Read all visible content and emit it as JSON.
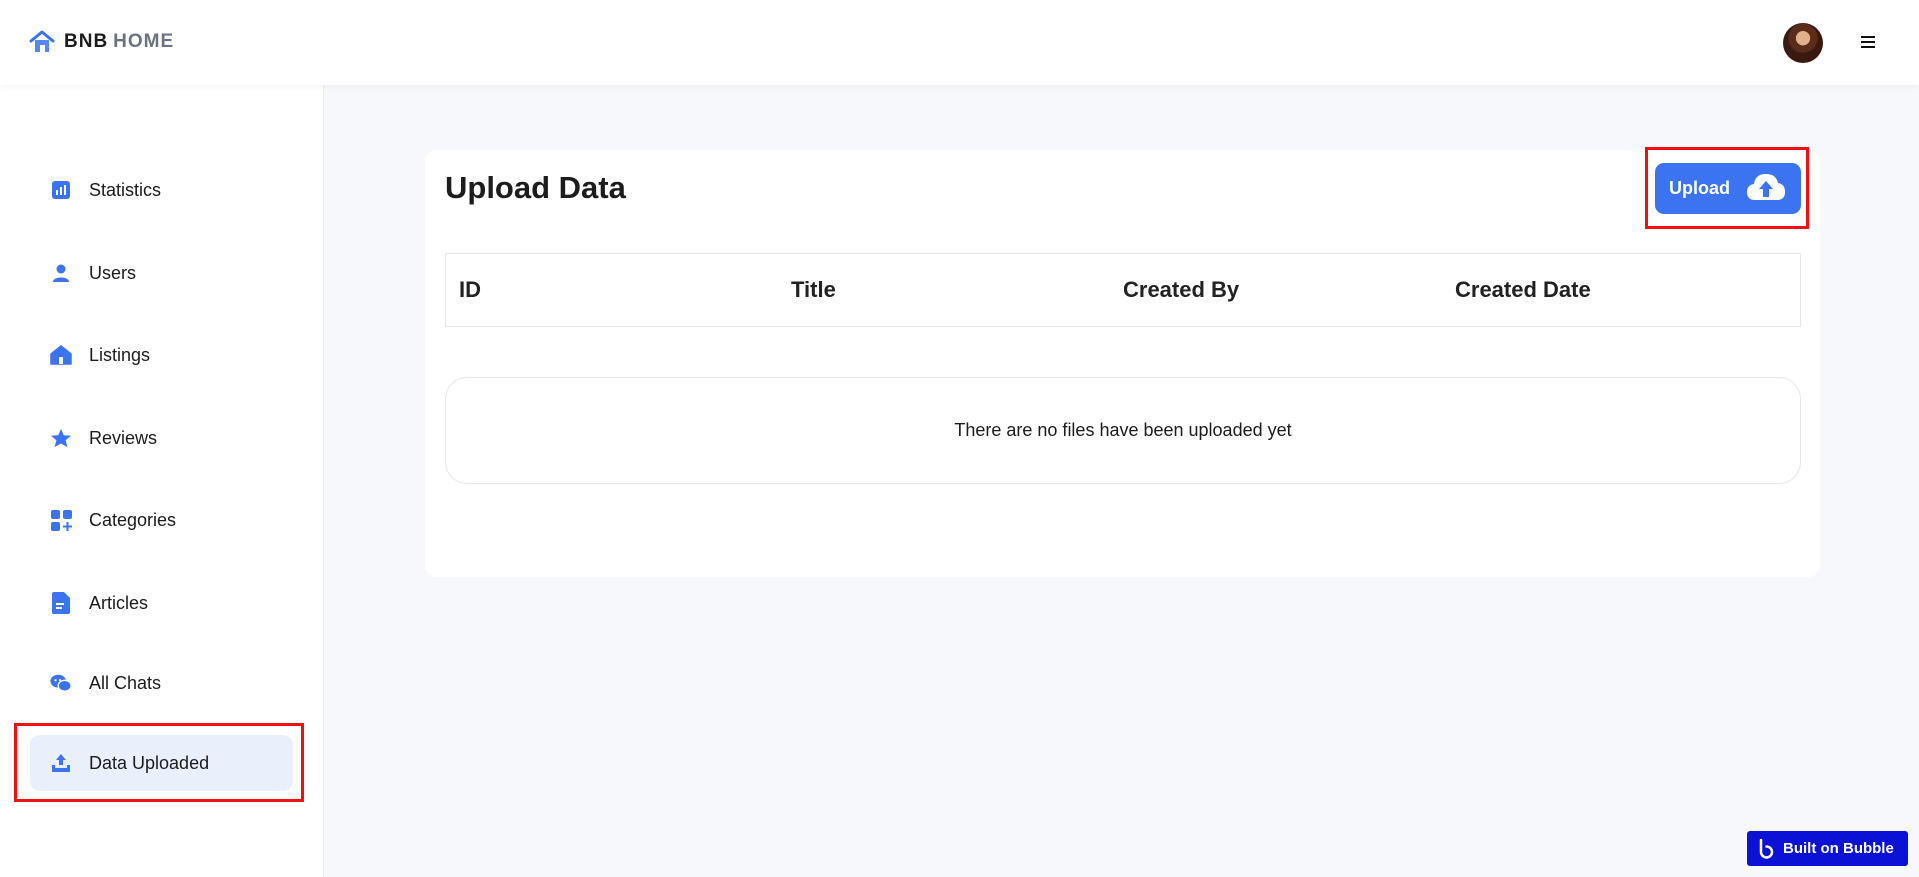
{
  "brand": {
    "name_part1": "BNB",
    "name_part2": "HOME",
    "accent": "#3b73f0"
  },
  "header": {
    "avatar_icon": "user-avatar",
    "menu_icon": "hamburger-menu-icon"
  },
  "sidebar": {
    "items": [
      {
        "label": "Statistics",
        "icon": "bar-chart-icon",
        "active": false
      },
      {
        "label": "Users",
        "icon": "user-icon",
        "active": false
      },
      {
        "label": "Listings",
        "icon": "home-icon",
        "active": false
      },
      {
        "label": "Reviews",
        "icon": "star-icon",
        "active": false
      },
      {
        "label": "Categories",
        "icon": "grid-plus-icon",
        "active": false
      },
      {
        "label": "Articles",
        "icon": "document-icon",
        "active": false
      },
      {
        "label": "All Chats",
        "icon": "chat-bubbles-icon",
        "active": false
      },
      {
        "label": "Data Uploaded",
        "icon": "upload-tray-icon",
        "active": true
      }
    ]
  },
  "main": {
    "title": "Upload Data",
    "upload_button": {
      "label": "Upload",
      "icon": "cloud-upload-icon"
    },
    "table": {
      "columns": [
        "ID",
        "Title",
        "Created By",
        "Created Date"
      ]
    },
    "empty_message": "There are no files have been uploaded yet"
  },
  "badge": {
    "label": "Built on Bubble",
    "icon": "bubble-logo-icon",
    "color": "#0b12d6"
  },
  "colors": {
    "highlight": "#ee1111",
    "active_bg": "#e9effb",
    "page_bg": "#f7f8fc"
  }
}
